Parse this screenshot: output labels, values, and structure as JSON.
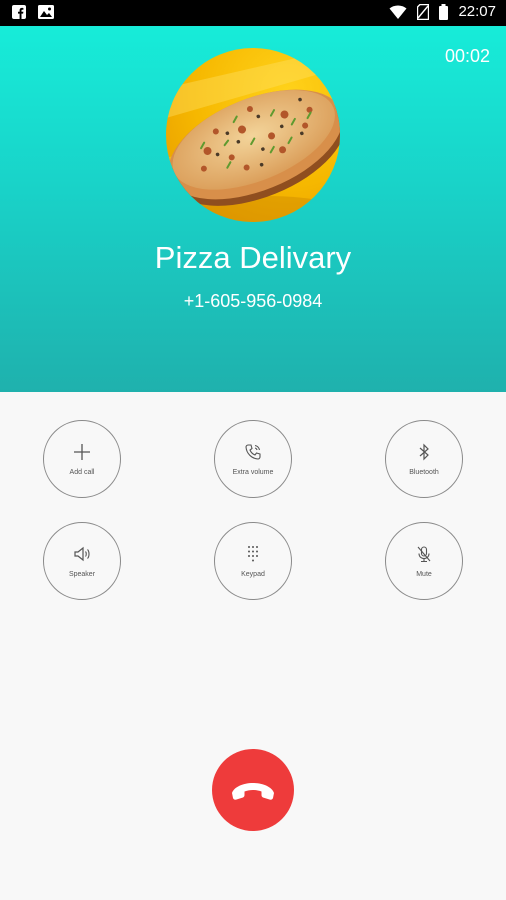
{
  "status_bar": {
    "left_icons": [
      "facebook-icon",
      "image-icon"
    ],
    "right_icons": [
      "wifi-icon",
      "no-sim-icon",
      "battery-icon"
    ],
    "time": "22:07"
  },
  "call": {
    "timer": "00:02",
    "contact_name": "Pizza Delivary",
    "phone_number": "+1-605-956-0984"
  },
  "controls": [
    {
      "label": "Add call",
      "icon": "plus-icon"
    },
    {
      "label": "Extra volume",
      "icon": "phone-volume-icon"
    },
    {
      "label": "Bluetooth",
      "icon": "bluetooth-icon"
    },
    {
      "label": "Speaker",
      "icon": "speaker-icon"
    },
    {
      "label": "Keypad",
      "icon": "keypad-icon"
    },
    {
      "label": "Mute",
      "icon": "mic-off-icon"
    }
  ],
  "colors": {
    "header_top": "#17ecd9",
    "header_bottom": "#1fb1ad",
    "end_call": "#ee3b3b",
    "background": "#f8f8f8"
  }
}
